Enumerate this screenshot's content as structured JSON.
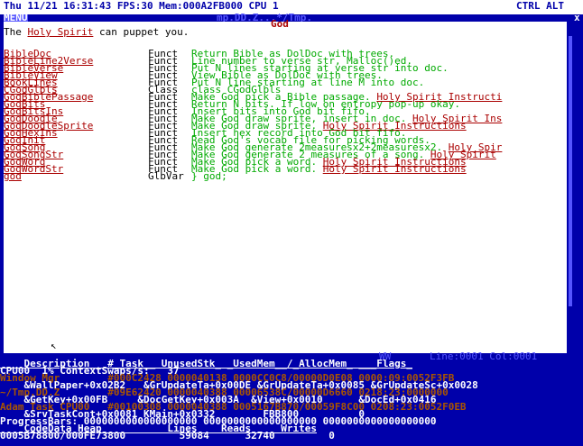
{
  "topbar": {
    "left": "Thu 11/21 16:31:43 FPS:30 Mem:000A2FB000 CPU 1",
    "right": "CTRL ALT",
    "menu": "MENU"
  },
  "window": {
    "title": "mp.DD.Z...*/Tmp.",
    "god_label": "God",
    "close": "x"
  },
  "intro": {
    "prefix": "The ",
    "link": "Holy Spirit",
    "suffix": " can puppet you."
  },
  "entries": [
    {
      "name": "BibleDoc",
      "kind": "Funct",
      "desc": "Return Bible as DolDoc with trees.",
      "link": ""
    },
    {
      "name": "BibleLine2Verse",
      "kind": "Funct",
      "desc": "Line number to verse str, Malloc()ed.",
      "link": ""
    },
    {
      "name": "BibleVerse",
      "kind": "Funct",
      "desc": "Put N lines starting at verse str into doc.",
      "link": ""
    },
    {
      "name": "BibleView",
      "kind": "Funct",
      "desc": "View Bible as DolDoc with trees.",
      "link": ""
    },
    {
      "name": "BookLines",
      "kind": "Funct",
      "desc": "Put N line starting at line M into doc.",
      "link": ""
    },
    {
      "name": "CGodGlbls",
      "kind": "Class",
      "desc": "class CGodGlbls",
      "link": ""
    },
    {
      "name": "GodBiblePassage",
      "kind": "Funct",
      "desc": "Make God pick a Bible passage.",
      "link": "Holy Spirit Instructi"
    },
    {
      "name": "GodBits",
      "kind": "Funct",
      "desc": "Return N bits. If low on entropy pop-up okay.",
      "link": ""
    },
    {
      "name": "GodBitsIns",
      "kind": "Funct",
      "desc": "Insert bits into God bit fifo.",
      "link": ""
    },
    {
      "name": "GodDoodle",
      "kind": "Funct",
      "desc": "Make God draw sprite, insert in doc.",
      "link": "Holy Spirit Ins"
    },
    {
      "name": "GodDoodleSprite",
      "kind": "Funct",
      "desc": "Make God draw sprite.",
      "link": "Holy Spirit Instructions"
    },
    {
      "name": "GodHexIns",
      "kind": "Funct",
      "desc": "Insert hex record into God bit fifo.",
      "link": ""
    },
    {
      "name": "GodInit",
      "kind": "Funct",
      "desc": "Read God's vocab file for picking words.",
      "link": ""
    },
    {
      "name": "GodSong",
      "kind": "Funct",
      "desc": "Make God generate 2measuresx2+2measuresx2.",
      "link": "Holy Spir"
    },
    {
      "name": "GodSongStr",
      "kind": "Funct",
      "desc": "Make God generate 2 measures of a song.",
      "link": "Holy Spirit"
    },
    {
      "name": "GodWord",
      "kind": "Funct",
      "desc": "Make God pick a word.",
      "link": "Holy Spirit Instructions"
    },
    {
      "name": "GodWordStr",
      "kind": "Funct",
      "desc": "Make God pick a word.",
      "link": "Holy Spirit Instructions"
    },
    {
      "name": "god",
      "kind": "GlbVar",
      "desc": "} god;",
      "link": ""
    }
  ],
  "status": {
    "ww": "WW",
    "line": "Line:0001 Col:0001"
  },
  "tasks": {
    "header1": "    Description   #_Task__ UnusedStk_ _UsedMem__/_AllocMem_ ___Flags_",
    "cpu": "CPU00  1% ContextSwaps/s:   37",
    "r1": "Window Mgr        #000C2428 0000040138 0000CC0C8/00000D0E08 0000:09:0052F3FB",
    "r2": "    &WallPaper+0x02B2   &GrUpdateTa+0x00DE &GrUpdateTa+0x0085 &GrUpdateSc+0x0028",
    "r3": "~/Tmp.DD.Z        #09E62420 0000040388 00006538C/00000D6660 0218:23:0000000",
    "r4": "    &GetKey+0x00FB     &DocGetKey+0x003A  &View+0x0010      &DocEd+0x0416",
    "r5": "Adam Task CPU00   #00100308 0000040388 0005167B870/00059F8C00 0208:23:0052F0EB",
    "r6": "    &SrvTaskCont+0x0081 KMain+0x0332        FBB800          0",
    "progress": "ProgressBars: 0000000000000000000 0000000000000000000 0000000000000000000",
    "hdr2": "    CodeData Heap           Lines    Reads     Writes",
    "bottom": "0005B78800/000FE73800         59084      32740         0"
  }
}
